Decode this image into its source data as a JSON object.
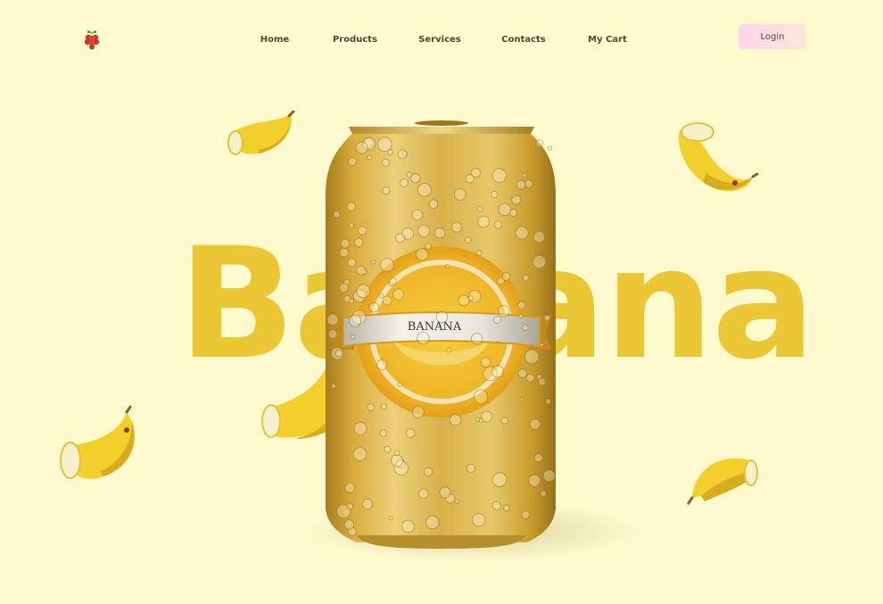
{
  "nav": {
    "items": [
      {
        "label": "Home"
      },
      {
        "label": "Products"
      },
      {
        "label": "Services"
      },
      {
        "label": "Contacts"
      },
      {
        "label": "My Cart"
      }
    ],
    "login_label": "Login"
  },
  "hero": {
    "word": "Banana",
    "can_label": "BANANA"
  },
  "colors": {
    "background": "#fefacd",
    "hero_text": "#ebc635",
    "can_gold": "#d6ac3c",
    "banana_yellow": "#f2cf2a",
    "login_gradient_start": "#fcd6ec",
    "login_gradient_end": "#fde6da",
    "logo_red": "#c9382c"
  },
  "icons": {
    "logo": "raspberry-icon"
  }
}
